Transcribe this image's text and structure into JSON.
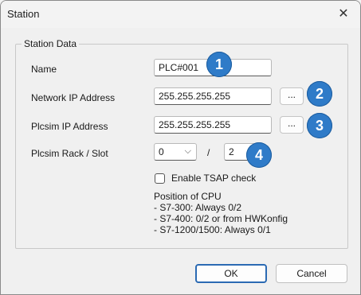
{
  "window": {
    "title": "Station",
    "close_glyph": "✕"
  },
  "group": {
    "label": "Station Data"
  },
  "fields": {
    "name": {
      "label": "Name",
      "value": "PLC#001",
      "badge": "1"
    },
    "network_ip": {
      "label": "Network IP Address",
      "value": "255.255.255.255",
      "browse": "...",
      "badge": "2"
    },
    "plcsim_ip": {
      "label": "Plcsim IP Address",
      "value": "255.255.255.255",
      "browse": "...",
      "badge": "3"
    },
    "rack_slot": {
      "label": "Plcsim Rack / Slot",
      "rack": "0",
      "separator": "/",
      "slot": "2",
      "badge": "4"
    }
  },
  "tsap": {
    "label": "Enable TSAP check",
    "checked": false
  },
  "info": {
    "heading": "Position of CPU",
    "lines": [
      "- S7-300: Always 0/2",
      "- S7-400: 0/2 or from HWKonfig",
      "- S7-1200/1500: Always 0/1"
    ]
  },
  "buttons": {
    "ok": "OK",
    "cancel": "Cancel"
  },
  "colors": {
    "badge": "#2f7bc8",
    "ok_border": "#2b6ab3"
  },
  "icons": {
    "close": "close-icon",
    "chevron": "chevron-down-icon"
  }
}
